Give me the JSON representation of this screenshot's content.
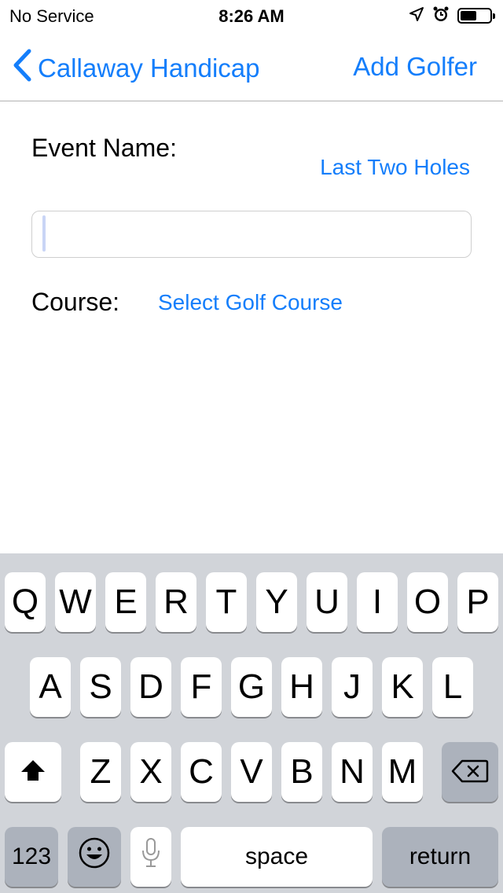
{
  "status_bar": {
    "carrier": "No Service",
    "time": "8:26 AM",
    "icons": [
      "location-arrow-icon",
      "alarm-icon",
      "battery-icon"
    ],
    "battery_level": 0.55
  },
  "nav": {
    "back_label": "Callaway Handicap",
    "right_label": "Add Golfer"
  },
  "form": {
    "event_name_label": "Event Name:",
    "last_two_holes_label": "Last Two Holes",
    "event_name_value": "",
    "course_label": "Course:",
    "select_course_label": "Select Golf Course"
  },
  "keyboard": {
    "row1": [
      "Q",
      "W",
      "E",
      "R",
      "T",
      "Y",
      "U",
      "I",
      "O",
      "P"
    ],
    "row2": [
      "A",
      "S",
      "D",
      "F",
      "G",
      "H",
      "J",
      "K",
      "L"
    ],
    "row3": [
      "Z",
      "X",
      "C",
      "V",
      "B",
      "N",
      "M"
    ],
    "numbers_label": "123",
    "space_label": "space",
    "return_label": "return"
  },
  "colors": {
    "accent": "#147efb",
    "keyboard_bg": "#d1d4d9",
    "key_gray": "#acb2bc"
  }
}
